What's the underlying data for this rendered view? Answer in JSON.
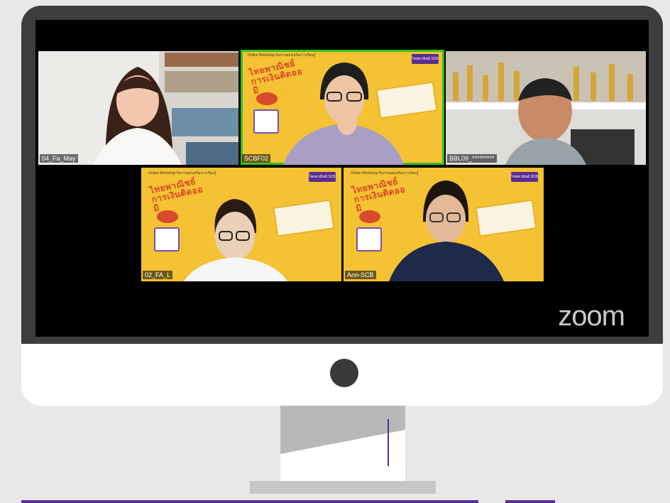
{
  "meeting": {
    "watermark": "zoom",
    "colors": {
      "active_speaker": "#35c020",
      "brand_purple": "#5b2d8e",
      "slide_yellow": "#f4c232"
    }
  },
  "participants": [
    {
      "name": "04_Fa_May",
      "active": false,
      "background": "bookshelf"
    },
    {
      "name": "SCBF02",
      "active": true,
      "background": "slide"
    },
    {
      "name": "BBL09_*********",
      "active": false,
      "background": "trophies"
    },
    {
      "name": "02_FA_L",
      "active": false,
      "background": "slide"
    },
    {
      "name": "Ann-SCB",
      "active": false,
      "background": "slide"
    }
  ],
  "slide": {
    "header": "Online Workshop กิจกรรมส่งเสริมการเรียนรู้",
    "thai_title": "ไทยพาณิชย์ การเงินติดออมิ",
    "logo": "ไทยพาณิชย์ SCB"
  },
  "icons": [
    "piggy-bank-icon",
    "receipt-icon",
    "money-ticket-icon",
    "camera-dot-icon"
  ]
}
